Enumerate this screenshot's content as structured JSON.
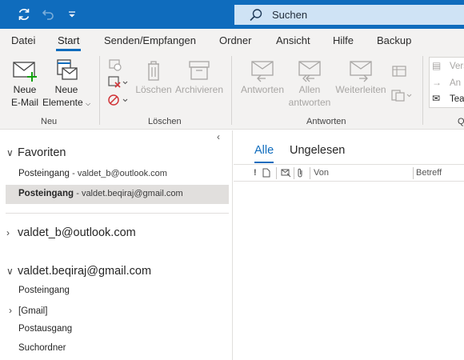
{
  "search": {
    "label": "Suchen"
  },
  "menu_tabs": [
    "Datei",
    "Start",
    "Senden/Empfangen",
    "Ordner",
    "Ansicht",
    "Hilfe",
    "Backup"
  ],
  "ribbon": {
    "new": {
      "new_email": [
        "Neue",
        "E-Mail"
      ],
      "new_items": [
        "Neue",
        "Elemente"
      ],
      "group": "Neu"
    },
    "delete": {
      "delete_label": "Löschen",
      "archive_label": "Archivieren",
      "group": "Löschen"
    },
    "respond": {
      "reply": "Antworten",
      "reply_all": [
        "Allen",
        "antworten"
      ],
      "forward": "Weiterleiten",
      "group": "Antworten"
    },
    "quick_steps": {
      "item1": "Vers",
      "item2": "An",
      "item3": "Tea",
      "group": "Q"
    }
  },
  "folder_pane": {
    "favorites": {
      "title": "Favoriten",
      "items": [
        {
          "name": "Posteingang",
          "account": "- valdet_b@outlook.com"
        },
        {
          "name": "Posteingang",
          "account": "- valdet.beqiraj@gmail.com"
        }
      ]
    },
    "account1": "valdet_b@outlook.com",
    "account2": {
      "title": "valdet.beqiraj@gmail.com",
      "folders": [
        "Posteingang",
        "[Gmail]",
        "Postausgang",
        "Suchordner"
      ]
    }
  },
  "message_list": {
    "tabs": [
      "Alle",
      "Ungelesen"
    ],
    "columns": {
      "from": "Von",
      "subject": "Betreff"
    }
  }
}
